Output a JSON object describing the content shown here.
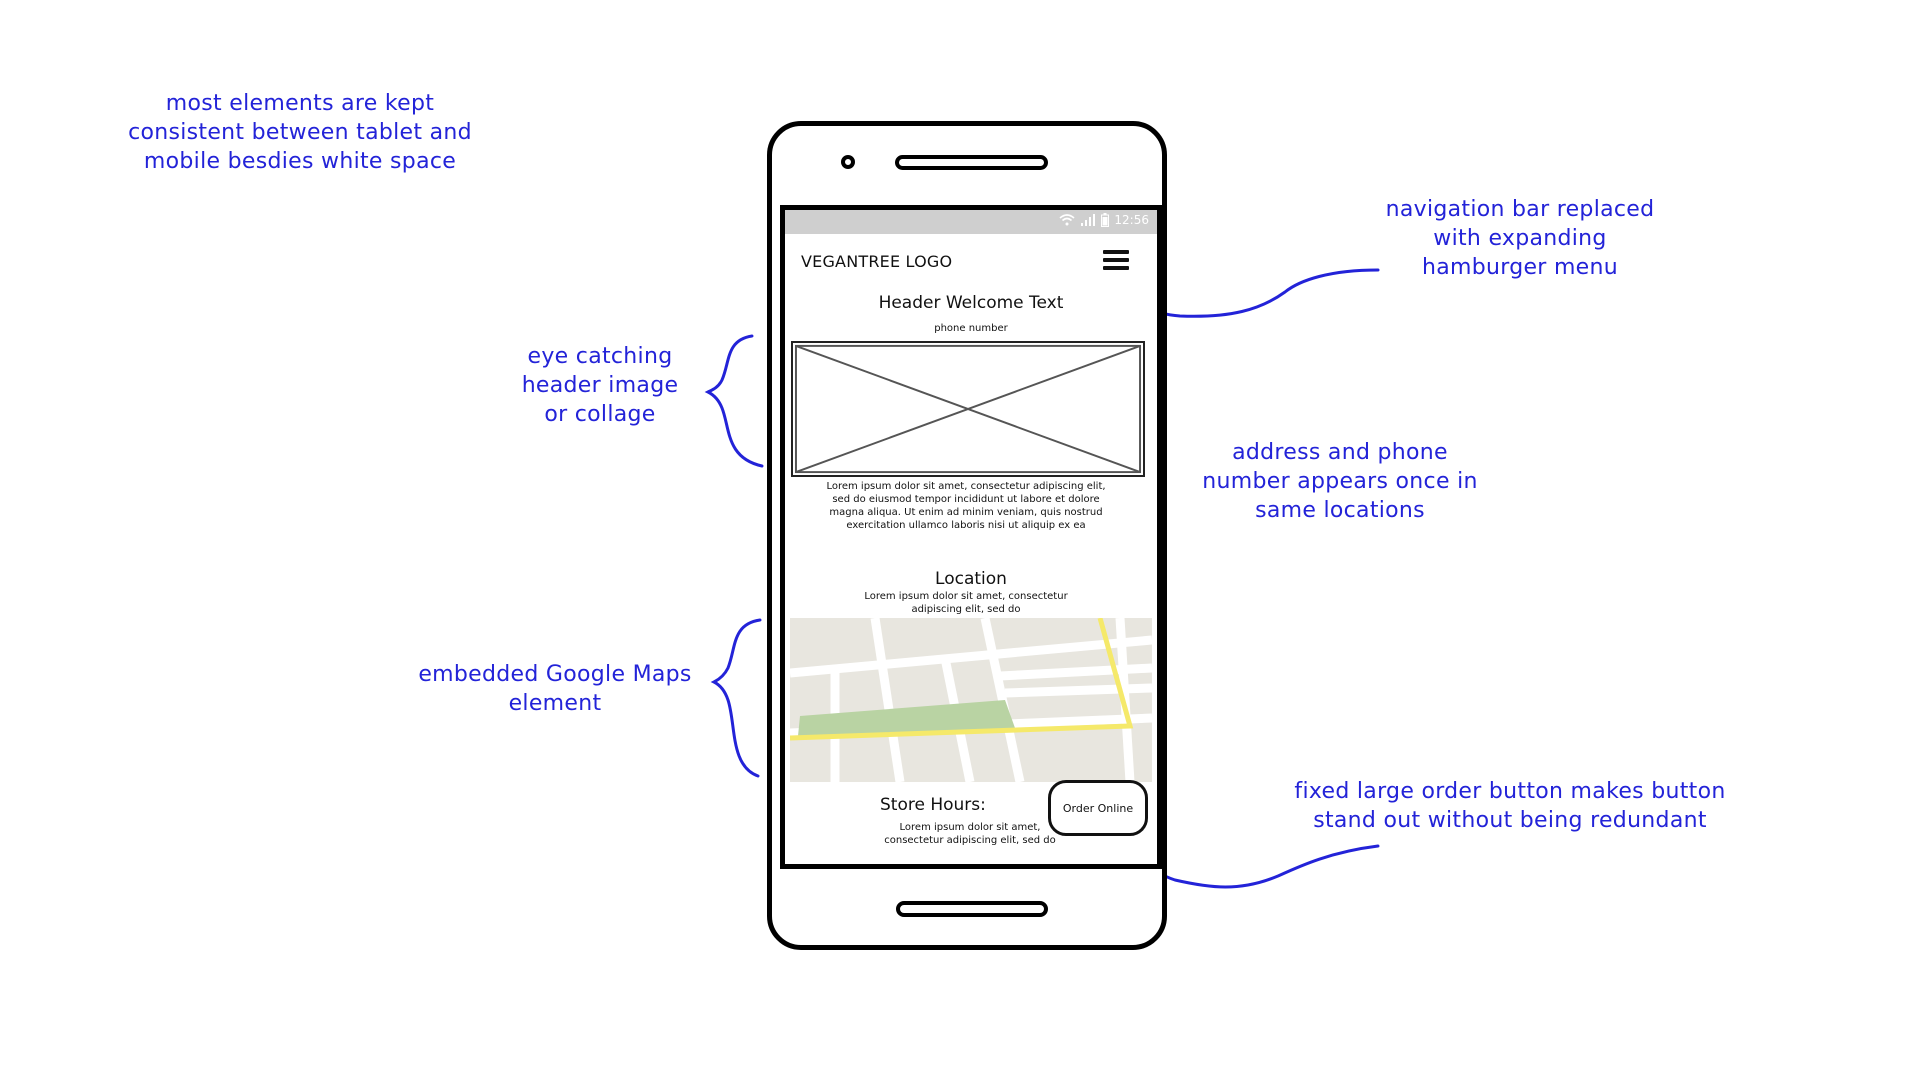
{
  "annotations": {
    "consistency": [
      "most elements are kept",
      "consistent between tablet and",
      "mobile besdies white space"
    ],
    "navigation": [
      "navigation bar replaced",
      "with expanding",
      "hamburger menu"
    ],
    "header_image": [
      "eye catching",
      "header image",
      "or collage"
    ],
    "address": [
      "address and phone",
      "number appears once in",
      "same locations"
    ],
    "maps": [
      "embedded Google Maps",
      "element"
    ],
    "order_button": [
      "fixed large order button makes button",
      "stand out without being redundant"
    ]
  },
  "phone": {
    "status_time": "12:56",
    "logo": "VEGANTREE LOGO",
    "header_text": "Header Welcome Text",
    "phone_number": "phone number",
    "body_text": "Lorem ipsum dolor sit amet, consectetur adipiscing elit, sed do eiusmod tempor incididunt ut labore et dolore magna aliqua. Ut enim ad minim veniam, quis nostrud exercitation ullamco laboris nisi ut aliquip ex ea",
    "location_title": "Location",
    "location_text": "Lorem ipsum dolor sit amet, consectetur adipiscing elit, sed do",
    "store_hours_title": "Store Hours:",
    "store_hours_text": "Lorem ipsum dolor sit amet, consectetur adipiscing elit, sed do",
    "order_button": "Order Online"
  },
  "colors": {
    "annotation": "#2323d8",
    "map_background": "#e8e6df",
    "map_park": "#b9d3a3",
    "map_highway": "#f5e96a",
    "status_bar": "#cfcfcf"
  }
}
